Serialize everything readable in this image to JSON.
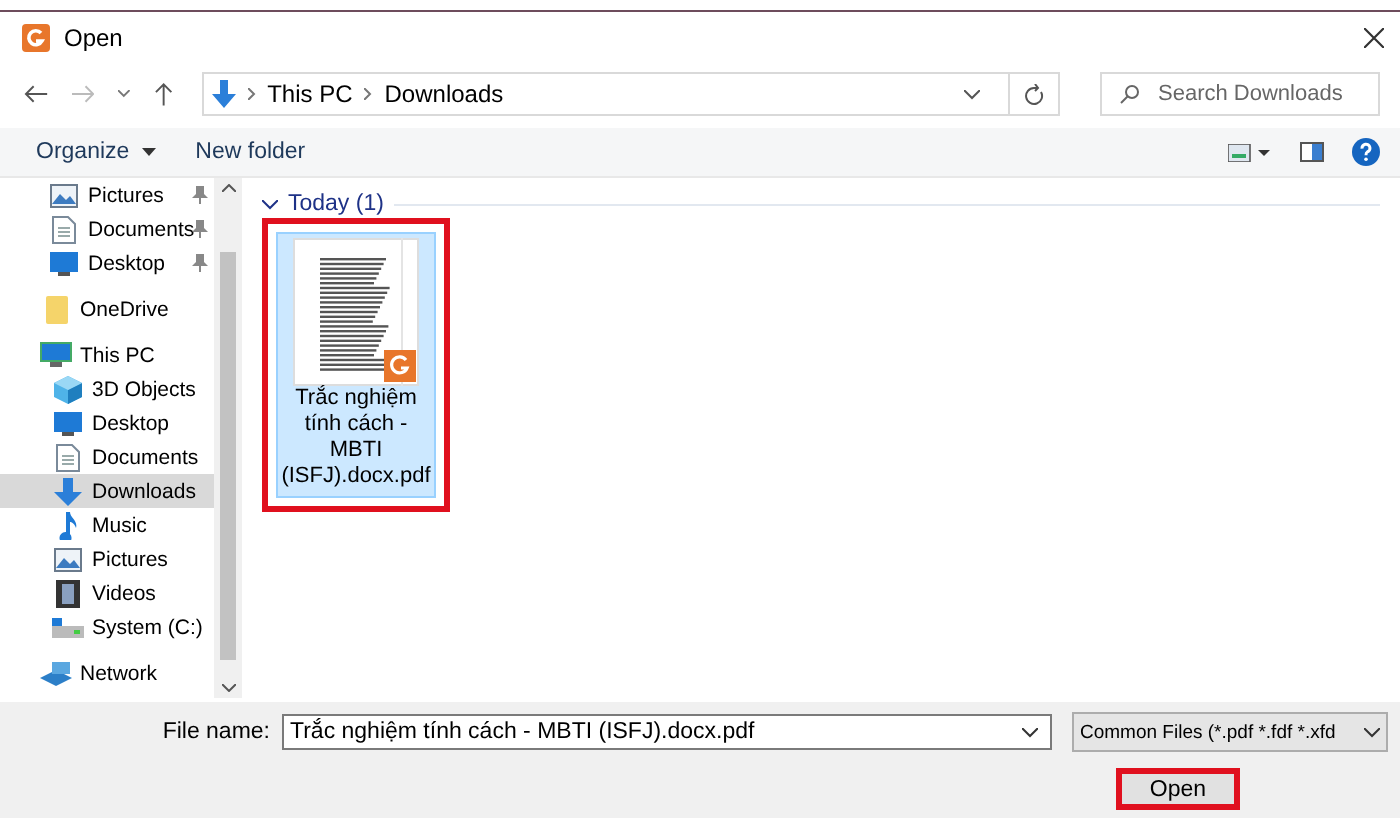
{
  "window": {
    "title": "Open"
  },
  "address": {
    "path": [
      "This PC",
      "Downloads"
    ],
    "search_placeholder": "Search Downloads"
  },
  "toolbar": {
    "organize": "Organize",
    "new_folder": "New folder"
  },
  "sidebar": {
    "items": [
      {
        "label": "Pictures",
        "kind": "pictures",
        "pinned": true,
        "selected": false
      },
      {
        "label": "Documents",
        "kind": "documents",
        "pinned": true,
        "selected": false
      },
      {
        "label": "Desktop",
        "kind": "desktop",
        "pinned": true,
        "selected": false
      },
      {
        "label": "OneDrive",
        "kind": "cloud",
        "pinned": false,
        "selected": false
      },
      {
        "label": "This PC",
        "kind": "computer",
        "pinned": false,
        "selected": false,
        "children": [
          {
            "label": "3D Objects",
            "kind": "objects",
            "pinned": false,
            "selected": false
          },
          {
            "label": "Desktop",
            "kind": "desktop",
            "pinned": false,
            "selected": false
          },
          {
            "label": "Documents",
            "kind": "documents",
            "pinned": false,
            "selected": false
          },
          {
            "label": "Downloads",
            "kind": "downloads",
            "pinned": false,
            "selected": true
          },
          {
            "label": "Music",
            "kind": "music",
            "pinned": false,
            "selected": false
          },
          {
            "label": "Pictures",
            "kind": "pictures",
            "pinned": false,
            "selected": false
          },
          {
            "label": "Videos",
            "kind": "videos",
            "pinned": false,
            "selected": false
          },
          {
            "label": "System (C:)",
            "kind": "drive",
            "pinned": false,
            "selected": false
          }
        ]
      },
      {
        "label": "Network",
        "kind": "network",
        "pinned": false,
        "selected": false
      }
    ]
  },
  "files": {
    "group": "Today (1)",
    "items": [
      {
        "name": "Trắc nghiệm tính cách - MBTI (ISFJ).docx.pdf",
        "selected": true,
        "highlighted": true
      }
    ]
  },
  "footer": {
    "file_name_label": "File name:",
    "file_name": "Trắc nghiệm tính cách - MBTI (ISFJ).docx.pdf",
    "filter": "Common Files (*.pdf *.fdf *.xfd",
    "buttons": [
      {
        "label": "Open",
        "highlighted": true
      }
    ]
  }
}
